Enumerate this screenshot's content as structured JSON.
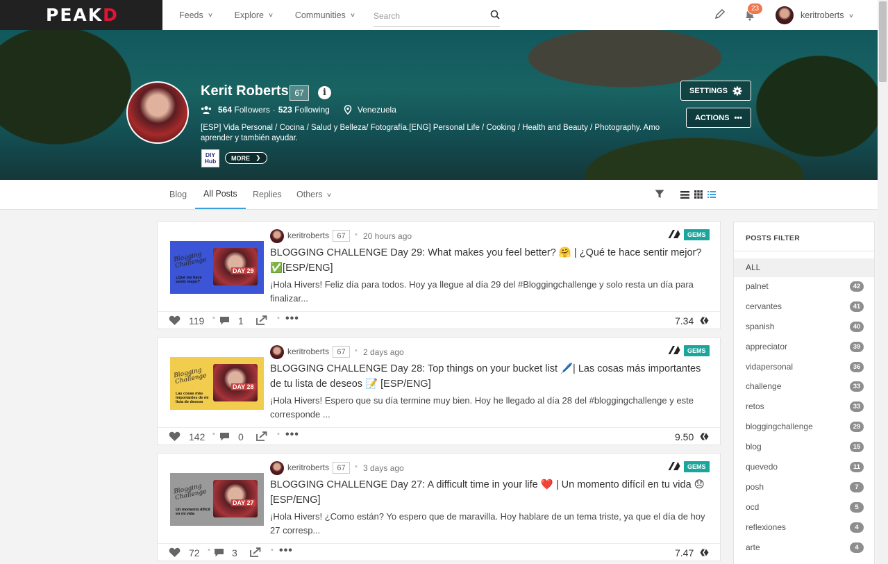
{
  "nav": {
    "logo_main": "PEAK",
    "logo_accent": "D",
    "feeds": "Feeds",
    "explore": "Explore",
    "communities": "Communities",
    "search_placeholder": "Search",
    "notifications_count": "23",
    "username": "keritroberts"
  },
  "profile": {
    "name": "Kerit Roberts",
    "reputation": "67",
    "info_glyph": "i",
    "followers_count": "564",
    "followers_label": "Followers",
    "following_count": "523",
    "following_label": "Following",
    "location": "Venezuela",
    "bio": "[ESP] Vida Personal / Cocina / Salud y Belleza/ Fotografía.[ENG] Personal Life / Cooking / Health and Beauty / Photography. Amo aprender y también ayudar.",
    "badge_line1": "DIY",
    "badge_line2": "Hub",
    "more_label": "MORE",
    "settings_label": "SETTINGS",
    "actions_label": "ACTIONS"
  },
  "tabs": [
    {
      "label": "Blog"
    },
    {
      "label": "All Posts"
    },
    {
      "label": "Replies"
    },
    {
      "label": "Others"
    }
  ],
  "posts": [
    {
      "author": "keritroberts",
      "rep": "67",
      "time": "20 hours ago",
      "badge": "GEMS",
      "title": "BLOGGING CHALLENGE Day 29: What makes you feel better? 🤗 | ¿Qué te hace sentir mejor? ✅[ESP/ENG]",
      "excerpt": "¡Hola Hivers! Feliz día para todos. Hoy ya llegue al día 29 del #Bloggingchallenge y solo resta un día para finalizar...",
      "votes": "119",
      "comments": "1",
      "payout": "7.34",
      "thumb_title": "Blogging Challenge",
      "thumb_sub": "¿Qué me hace sentir mejor?",
      "thumb_day": "DAY 29",
      "thumb_bg": "#3b55d6"
    },
    {
      "author": "keritroberts",
      "rep": "67",
      "time": "2 days ago",
      "badge": "GEMS",
      "title": "BLOGGING CHALLENGE Day 28: Top things on your bucket list 🖊️| Las cosas más importantes de tu lista de deseos 📝 [ESP/ENG]",
      "excerpt": "¡Hola Hivers! Espero que su día termine muy bien. Hoy he llegado al día 28 del #bloggingchallenge y este corresponde ...",
      "votes": "142",
      "comments": "0",
      "payout": "9.50",
      "thumb_title": "Blogging Challenge",
      "thumb_sub": "Las cosas más importantes de mi lista de deseos",
      "thumb_day": "DAY 28",
      "thumb_bg": "#f2cc4d"
    },
    {
      "author": "keritroberts",
      "rep": "67",
      "time": "3 days ago",
      "badge": "GEMS",
      "title": "BLOGGING CHALLENGE Day 27: A difficult time in your life ❤️ | Un momento difícil en tu vida 😞 [ESP/ENG]",
      "excerpt": "¡Hola Hivers! ¿Como están? Yo espero que de maravilla. Hoy hablare de un tema triste, ya que el día de hoy 27 corresp...",
      "votes": "72",
      "comments": "3",
      "payout": "7.47",
      "thumb_title": "Blogging Challenge",
      "thumb_sub": "Un momento difícil en mi vida",
      "thumb_day": "DAY 27",
      "thumb_bg": "#9a9a9a"
    }
  ],
  "sidebar": {
    "title": "POSTS FILTER",
    "all_label": "ALL",
    "items": [
      {
        "tag": "palnet",
        "count": "42"
      },
      {
        "tag": "cervantes",
        "count": "41"
      },
      {
        "tag": "spanish",
        "count": "40"
      },
      {
        "tag": "appreciator",
        "count": "39"
      },
      {
        "tag": "vidapersonal",
        "count": "36"
      },
      {
        "tag": "challenge",
        "count": "33"
      },
      {
        "tag": "retos",
        "count": "33"
      },
      {
        "tag": "bloggingchallenge",
        "count": "29"
      },
      {
        "tag": "blog",
        "count": "15"
      },
      {
        "tag": "quevedo",
        "count": "11"
      },
      {
        "tag": "posh",
        "count": "7"
      },
      {
        "tag": "ocd",
        "count": "5"
      },
      {
        "tag": "reflexiones",
        "count": "4"
      },
      {
        "tag": "arte",
        "count": "4"
      }
    ]
  },
  "colors": {
    "accent": "#3aa0d9",
    "gems": "#1aa69c",
    "badge": "#f0774d",
    "logo_accent": "#e31337"
  }
}
